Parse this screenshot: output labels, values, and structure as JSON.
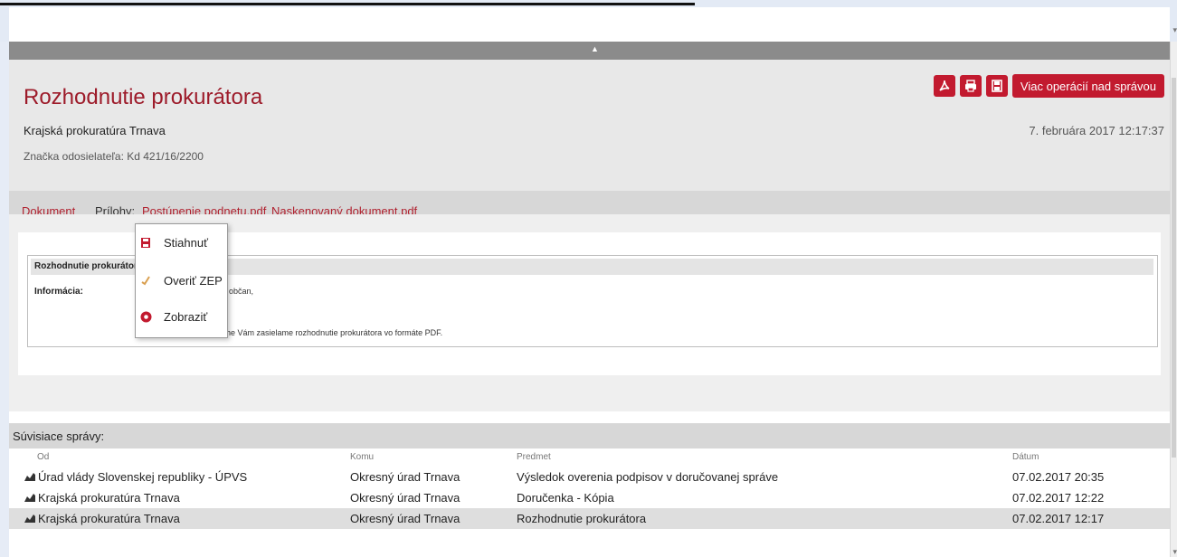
{
  "message": {
    "title": "Rozhodnutie prokurátora",
    "sender": "Krajská prokuratúra Trnava",
    "sender_ref": "Značka odosielateľa: Kd 421/16/2200",
    "date": "7. februára 2017 12:17:37"
  },
  "actions": {
    "more_label": "Viac operácií nad správou",
    "icons": [
      "pdf-icon",
      "print-icon",
      "save-icon"
    ]
  },
  "tabs": {
    "document": "Dokument",
    "attachments_label": "Prílohy:",
    "attachment_1": "Postúpenie podnetu.pdf",
    "attachment_2": "Naskenovaný dokument.pdf"
  },
  "context_menu": {
    "items": [
      {
        "label": "Stiahnuť",
        "icon": "save-icon"
      },
      {
        "label": "Overiť ZEP",
        "icon": "verify-icon"
      },
      {
        "label": "Zobraziť",
        "icon": "view-icon"
      }
    ]
  },
  "form": {
    "heading": "Rozhodnutie prokurátora",
    "info_label": "Informácia:",
    "text_1": "občan,",
    "text_2": "V prílohe Vám zasielame rozhodnutie prokurátora vo formáte PDF."
  },
  "related": {
    "title": "Súvisiace správy:",
    "columns": {
      "from": "Od",
      "to": "Komu",
      "subject": "Predmet",
      "date": "Dátum"
    },
    "rows": [
      {
        "from": "Úrad vlády Slovenskej republiky - ÚPVS",
        "to": "Okresný úrad Trnava",
        "subject": "Výsledok overenia podpisov v doručovanej správe",
        "date": "07.02.2017 20:35"
      },
      {
        "from": "Krajská prokuratúra Trnava",
        "to": "Okresný úrad Trnava",
        "subject": "Doručenka - Kópia",
        "date": "07.02.2017 12:22"
      },
      {
        "from": "Krajská prokuratúra Trnava",
        "to": "Okresný úrad Trnava",
        "subject": "Rozhodnutie prokurátora",
        "date": "07.02.2017 12:17"
      }
    ]
  },
  "colors": {
    "accent": "#c21a2f",
    "title": "#9d1b2a",
    "link": "#b0212f"
  }
}
